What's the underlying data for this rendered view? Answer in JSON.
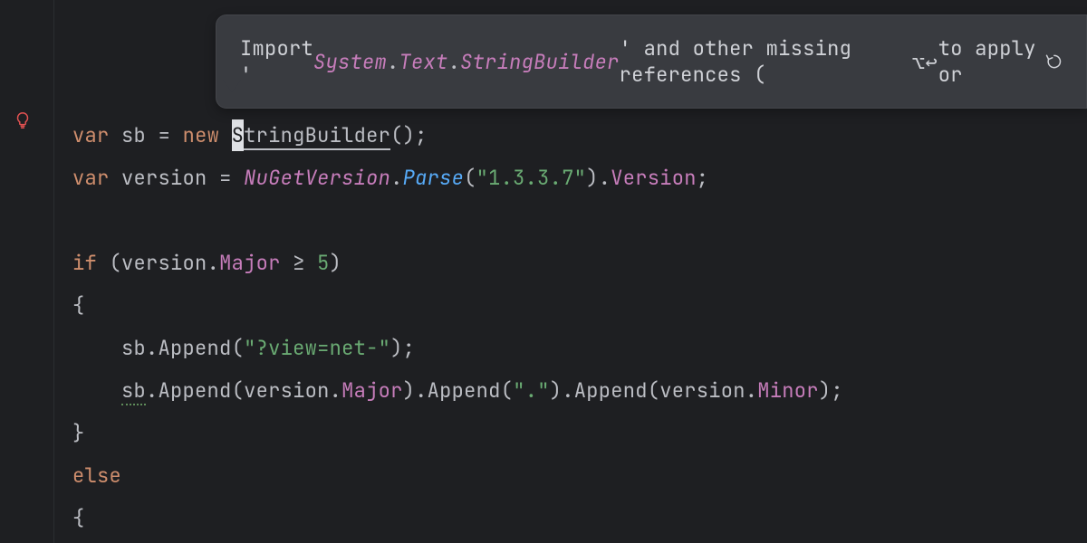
{
  "tooltip": {
    "prefix": "Import '",
    "ns1": "System",
    "dot1": ".",
    "ns2": "Text",
    "dot2": ".",
    "cls": "StringBuilder",
    "suffix": "' and other missing references (",
    "shortcut": "⌥↩",
    "apply": " to apply or "
  },
  "code": {
    "line1": {
      "kw_var": "var",
      "sp1": " ",
      "sb": "sb",
      "sp2": " ",
      "eq": "=",
      "sp3": " ",
      "kw_new": "new",
      "sp4": " ",
      "cursor": "S",
      "type_rest": "tringBuilder",
      "parens": "();"
    },
    "line2": {
      "kw_var": "var",
      "sp1": " ",
      "vname": "version",
      "sp2": " ",
      "eq": "=",
      "sp3": " ",
      "type": "NuGetVersion",
      "dot1": ".",
      "method": "Parse",
      "paren_o": "(",
      "str": "\"1.3.3.7\"",
      "paren_c": ")",
      "dot2": ".",
      "prop": "Version",
      "semi": ";"
    },
    "line3": "",
    "line4": {
      "kw_if": "if",
      "sp1": " ",
      "paren_o": "(",
      "ident": "version",
      "dot1": ".",
      "prop": "Major",
      "sp2": " ",
      "op": "≥",
      "sp3": " ",
      "num": "5",
      "paren_c": ")"
    },
    "line5": {
      "brace": "{"
    },
    "line6": {
      "indent": "    ",
      "ident": "sb",
      "dot1": ".",
      "method": "Append",
      "paren_o": "(",
      "str": "\"?view=net-\"",
      "paren_c": ")",
      "semi": ";"
    },
    "line7": {
      "indent": "    ",
      "ident": "sb",
      "dot1": ".",
      "method1": "Append",
      "paren1o": "(",
      "vname1": "version",
      "dot2": ".",
      "prop1": "Major",
      "paren1c": ")",
      "dot3": ".",
      "method2": "Append",
      "paren2o": "(",
      "str": "\".\"",
      "paren2c": ")",
      "dot4": ".",
      "method3": "Append",
      "paren3o": "(",
      "vname2": "version",
      "dot5": ".",
      "prop2": "Minor",
      "paren3c": ")",
      "semi": ";"
    },
    "line8": {
      "brace": "}"
    },
    "line9": {
      "kw_else": "else"
    },
    "line10": {
      "brace": "{"
    }
  }
}
